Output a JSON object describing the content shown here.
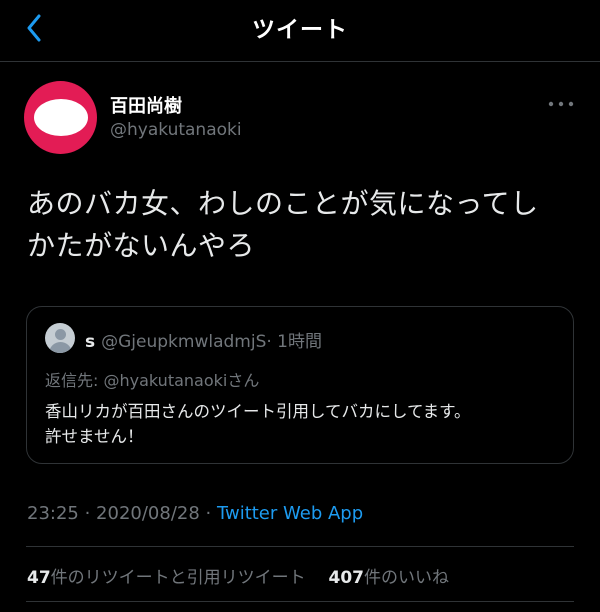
{
  "header": {
    "title": "ツイート",
    "back_icon": "chevron-left-icon",
    "accent": "#1d9bf0"
  },
  "tweet": {
    "author": {
      "name": "百田尚樹",
      "handle": "@hyakutanaoki",
      "avatar_color": "#e31c55"
    },
    "more_icon": "more-horizontal-icon",
    "text_line1": "あのバカ女、わしのことが気になってし",
    "text_line2": "かたがないんやろ",
    "time": "23:25 · 2020/08/28 · ",
    "source": "Twitter Web App"
  },
  "quote": {
    "name": "s",
    "handle": "@GjeupkmwladmjS",
    "age": "· 1時間",
    "reply_prefix": "返信先: ",
    "reply_handle": "@hyakutanaoki",
    "reply_suffix": "さん",
    "text_line1": "香山リカが百田さんのツイート引用してバカにしてます。",
    "text_line2": "許せません！"
  },
  "stats": {
    "retweets_count": "47",
    "retweets_label": "件のリツイートと引用リツイート",
    "likes_count": "407",
    "likes_label": "件のいいね"
  }
}
